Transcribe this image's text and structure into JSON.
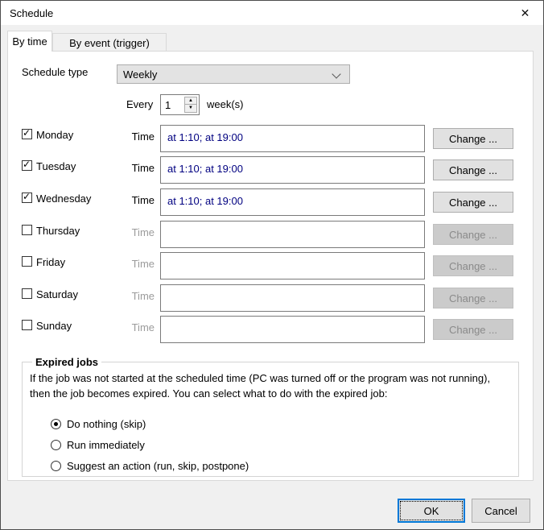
{
  "window": {
    "title": "Schedule",
    "close_icon": "✕"
  },
  "tabs": [
    {
      "label": "By time",
      "active": true
    },
    {
      "label": "By event (trigger)",
      "active": false
    }
  ],
  "schedule_type": {
    "label": "Schedule type",
    "value": "Weekly"
  },
  "every": {
    "label": "Every",
    "value": "1",
    "unit": "week(s)"
  },
  "row_labels": {
    "time": "Time",
    "change": "Change ..."
  },
  "days": [
    {
      "name": "Monday",
      "checked": true,
      "time": "at 1:10; at 19:00"
    },
    {
      "name": "Tuesday",
      "checked": true,
      "time": "at 1:10; at 19:00"
    },
    {
      "name": "Wednesday",
      "checked": true,
      "time": "at 1:10; at 19:00"
    },
    {
      "name": "Thursday",
      "checked": false,
      "time": ""
    },
    {
      "name": "Friday",
      "checked": false,
      "time": ""
    },
    {
      "name": "Saturday",
      "checked": false,
      "time": ""
    },
    {
      "name": "Sunday",
      "checked": false,
      "time": ""
    }
  ],
  "expired_jobs": {
    "title": "Expired jobs",
    "description": "If the job was not started at the scheduled time (PC was turned off or the program was not running), then the job becomes expired. You can select what to do with the expired job:",
    "options": [
      {
        "label": "Do nothing (skip)",
        "selected": true
      },
      {
        "label": "Run immediately",
        "selected": false
      },
      {
        "label": "Suggest an action (run, skip, postpone)",
        "selected": false
      }
    ]
  },
  "footer": {
    "ok": "OK",
    "cancel": "Cancel"
  },
  "spinner_icons": {
    "up": "▲",
    "down": "▼"
  },
  "colors": {
    "accent": "#0078d7",
    "time_text": "#000080",
    "titlebar_bg": "#ffffff",
    "body_bg": "#f0f0f0",
    "panel_bg": "#ffffff"
  }
}
